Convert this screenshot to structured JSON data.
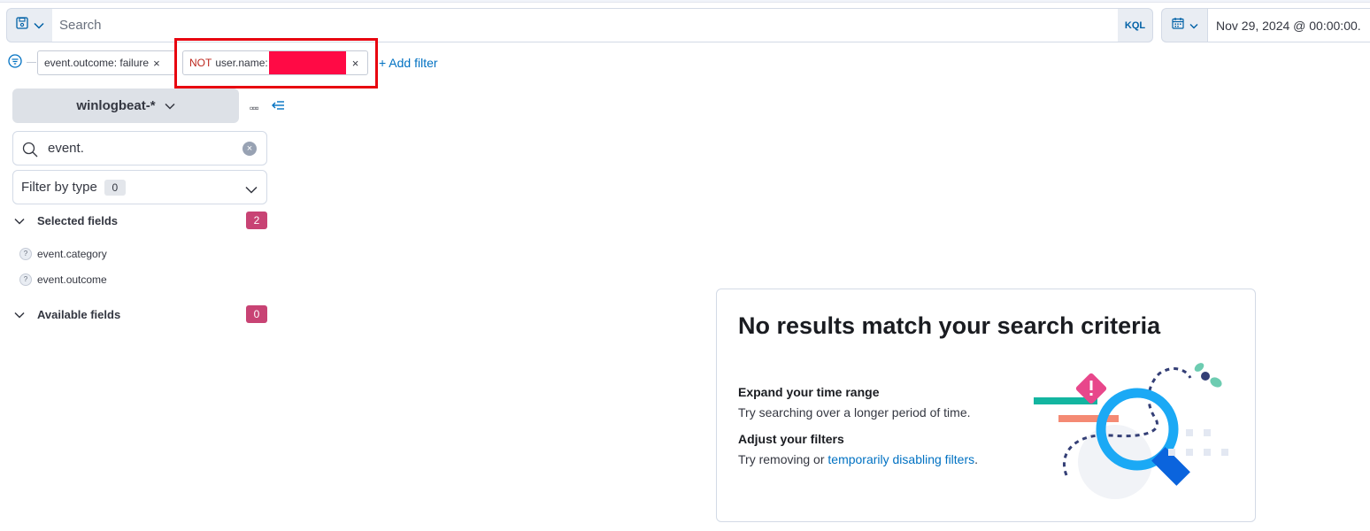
{
  "query_bar": {
    "search_placeholder": "Search",
    "language_label": "KQL",
    "date_start": "Nov 29, 2024 @ 00:00:00."
  },
  "filters": {
    "pill1_text": "event.outcome: failure",
    "pill2_negation": "NOT",
    "pill2_field": "user.name:",
    "add_filter_label": "+ Add filter",
    "redaction_color": "#ff0a45",
    "annotation_color": "#e8030f"
  },
  "sidebar": {
    "index_pattern": "winlogbeat-*",
    "field_search_value": "event.",
    "filter_by_type_label": "Filter by type",
    "filter_by_type_count": "0",
    "selected_fields_label": "Selected fields",
    "selected_fields_count": "2",
    "selected_fields": [
      {
        "name": "event.category",
        "type_icon": "question-icon"
      },
      {
        "name": "event.outcome",
        "type_icon": "question-icon"
      }
    ],
    "available_fields_label": "Available fields",
    "available_fields_count": "0",
    "badge_color": "#c84374"
  },
  "empty_state": {
    "title": "No results match your search criteria",
    "tip1_heading": "Expand your time range",
    "tip1_body": "Try searching over a longer period of time.",
    "tip2_heading": "Adjust your filters",
    "tip2_body_prefix": "Try removing or ",
    "tip2_link": "temporarily disabling filters",
    "tip2_body_suffix": "."
  }
}
